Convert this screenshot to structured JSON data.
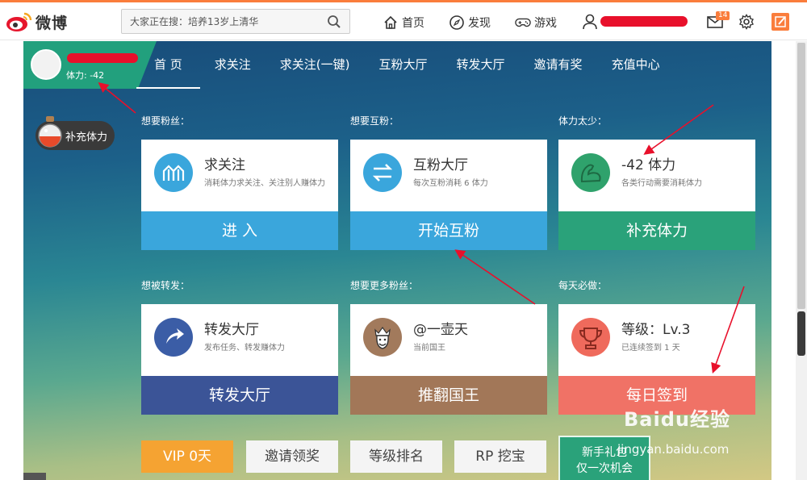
{
  "topbar": {
    "logo_text": "微博",
    "search_placeholder": "大家正在搜：培养13岁上清华",
    "nav": [
      {
        "icon": "home-icon",
        "label": "首页"
      },
      {
        "icon": "compass-icon",
        "label": "发现"
      },
      {
        "icon": "gamepad-icon",
        "label": "游戏"
      }
    ],
    "mail_badge": "14"
  },
  "profile": {
    "stamina": "体力: -42"
  },
  "navbar": [
    "首 页",
    "求关注",
    "求关注(一键)",
    "互粉大厅",
    "转发大厅",
    "邀请有奖",
    "充值中心"
  ],
  "potion_label": "补充体力",
  "sections": [
    {
      "label": "想要粉丝：",
      "title": "求关注",
      "desc": "消耗体力求关注、关注别人赚体力",
      "action": "进 入",
      "icon": "up-arrows-icon",
      "icon_color": "#3aa6dc",
      "action_color": "#3aa6dc"
    },
    {
      "label": "想要互粉：",
      "title": "互粉大厅",
      "desc": "每次互粉消耗 6 体力",
      "action": "开始互粉",
      "icon": "swap-arrows-icon",
      "icon_color": "#3aa6dc",
      "action_color": "#3aa6dc"
    },
    {
      "label": "体力太少：",
      "title": "-42 体力",
      "desc": "各类行动需要消耗体力",
      "action": "补充体力",
      "icon": "muscle-arm-icon",
      "icon_color": "#2fa26c",
      "action_color": "#2aa27a"
    },
    {
      "label": "想被转发：",
      "title": "转发大厅",
      "desc": "发布任务、转发赚体力",
      "action": "转发大厅",
      "icon": "forward-arrow-icon",
      "icon_color": "#3b5da6",
      "action_color": "#3b5497"
    },
    {
      "label": "想要更多粉丝：",
      "title": "@一壶天",
      "desc": "当前国王",
      "action": "推翻国王",
      "icon": "king-icon",
      "icon_color": "#a27a5c",
      "action_color": "#a27758"
    },
    {
      "label": "每天必做：",
      "title": "等级：Lv.3",
      "desc": "已连续签到 1 天",
      "action": "每日签到",
      "icon": "trophy-icon",
      "icon_color": "#ef6a5c",
      "action_color": "#f07266"
    }
  ],
  "bottom_buttons": [
    {
      "label": "VIP 0天",
      "bg": "#f5a332",
      "color": "#fff"
    },
    {
      "label": "邀请领奖",
      "bg": "#f4f4f4",
      "color": "#444"
    },
    {
      "label": "等级排名",
      "bg": "#f4f4f4",
      "color": "#444"
    },
    {
      "label": "RP 挖宝",
      "bg": "#f4f4f4",
      "color": "#444"
    }
  ],
  "novice": {
    "line1": "新手礼包",
    "line2": "仅一次机会"
  },
  "watermark": {
    "brand": "Baidu经验",
    "url": "jingyan.baidu.com"
  }
}
